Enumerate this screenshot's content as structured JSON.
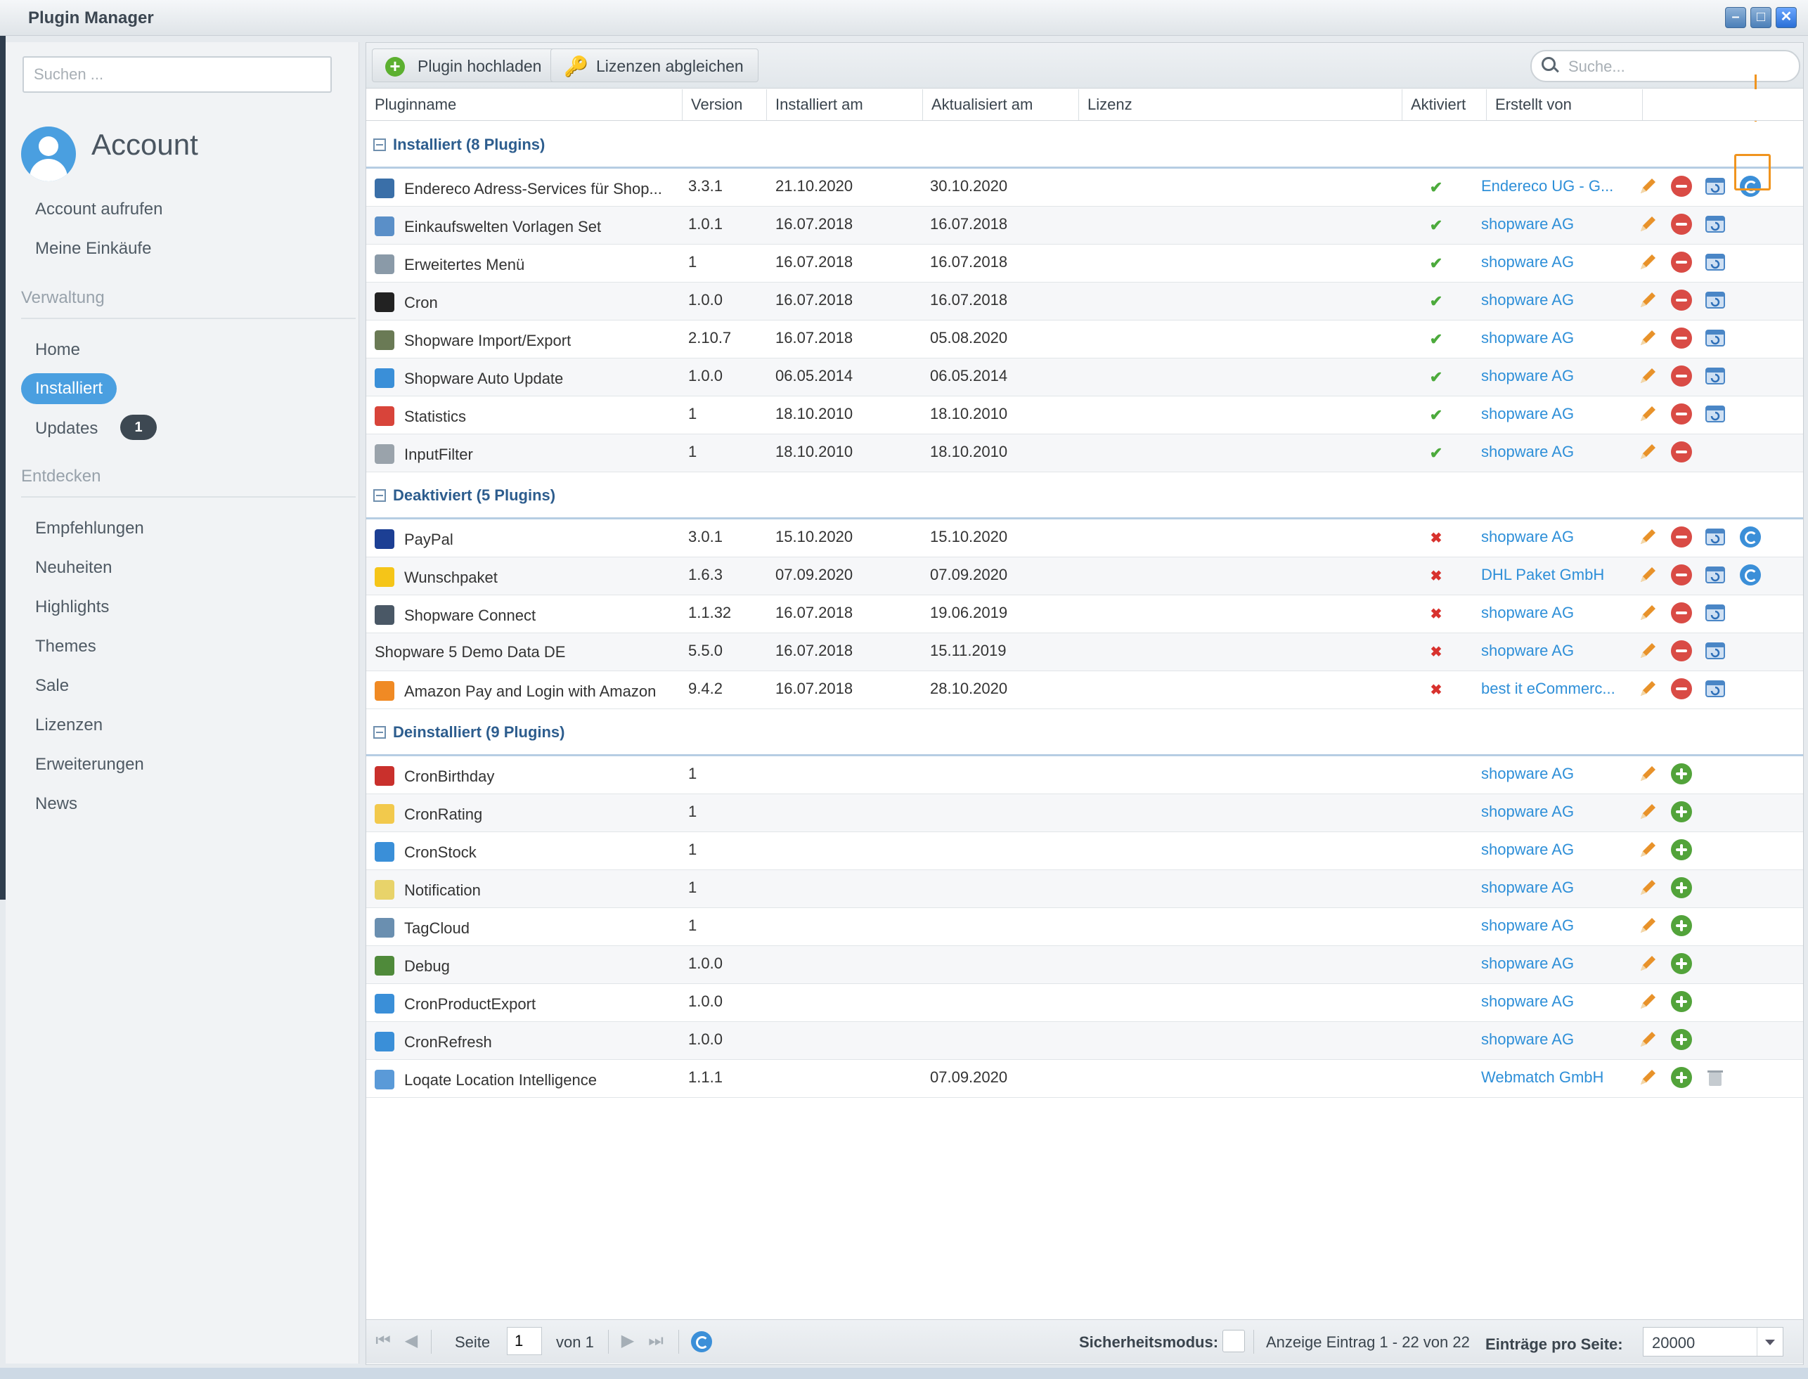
{
  "window": {
    "title": "Plugin Manager"
  },
  "sidebar": {
    "search_placeholder": "Suchen ...",
    "account_title": "Account",
    "account_items": [
      "Account aufrufen",
      "Meine Einkäufe"
    ],
    "sections": [
      {
        "label": "Verwaltung",
        "items": [
          "Home",
          "Installiert",
          "Updates"
        ]
      },
      {
        "label": "Entdecken",
        "items": [
          "Empfehlungen",
          "Neuheiten",
          "Highlights",
          "Themes",
          "Sale",
          "Lizenzen",
          "Erweiterungen",
          "News"
        ]
      }
    ],
    "active_item": "Installiert",
    "updates_badge": "1"
  },
  "toolbar": {
    "upload_label": "Plugin hochladen",
    "licenses_label": "Lizenzen abgleichen",
    "search_placeholder": "Suche..."
  },
  "columns": [
    "Pluginname",
    "Version",
    "Installiert am",
    "Aktualisiert am",
    "Lizenz",
    "Aktiviert",
    "Erstellt von"
  ],
  "groups": [
    {
      "title": "Installiert (8 Plugins)",
      "rows": [
        {
          "name": "Endereco Adress-Services für Shop...",
          "version": "3.3.1",
          "installed": "21.10.2020",
          "updated": "30.10.2020",
          "active": "✔",
          "by": "Endereco UG - G...",
          "icon": "envelope-icon",
          "icon_color": "#3a6fa8",
          "actions": [
            "edit",
            "remove",
            "reinstall",
            "update"
          ]
        },
        {
          "name": "Einkaufswelten Vorlagen Set",
          "version": "1.0.1",
          "installed": "16.07.2018",
          "updated": "16.07.2018",
          "active": "✔",
          "by": "shopware AG",
          "icon": "layout-icon",
          "icon_color": "#5a8fc8",
          "actions": [
            "edit",
            "remove",
            "reinstall"
          ]
        },
        {
          "name": "Erweitertes Menü",
          "version": "1",
          "installed": "16.07.2018",
          "updated": "16.07.2018",
          "active": "✔",
          "by": "shopware AG",
          "icon": "menu-icon",
          "icon_color": "#8a9aa8",
          "actions": [
            "edit",
            "remove",
            "reinstall"
          ]
        },
        {
          "name": "Cron",
          "version": "1.0.0",
          "installed": "16.07.2018",
          "updated": "16.07.2018",
          "active": "✔",
          "by": "shopware AG",
          "icon": "terminal-icon",
          "icon_color": "#222222",
          "actions": [
            "edit",
            "remove",
            "reinstall"
          ]
        },
        {
          "name": "Shopware Import/Export",
          "version": "2.10.7",
          "installed": "16.07.2018",
          "updated": "05.08.2020",
          "active": "✔",
          "by": "shopware AG",
          "icon": "import-export-icon",
          "icon_color": "#6a7a55",
          "actions": [
            "edit",
            "remove",
            "reinstall"
          ]
        },
        {
          "name": "Shopware Auto Update",
          "version": "1.0.0",
          "installed": "06.05.2014",
          "updated": "06.05.2014",
          "active": "✔",
          "by": "shopware AG",
          "icon": "sync-icon",
          "icon_color": "#3a8fd8",
          "actions": [
            "edit",
            "remove",
            "reinstall"
          ]
        },
        {
          "name": "Statistics",
          "version": "1",
          "installed": "18.10.2010",
          "updated": "18.10.2010",
          "active": "✔",
          "by": "shopware AG",
          "icon": "pie-chart-icon",
          "icon_color": "#d8443a",
          "actions": [
            "edit",
            "remove",
            "reinstall"
          ]
        },
        {
          "name": "InputFilter",
          "version": "1",
          "installed": "18.10.2010",
          "updated": "18.10.2010",
          "active": "✔",
          "by": "shopware AG",
          "icon": "text-cursor-icon",
          "icon_color": "#9aa3ab",
          "actions": [
            "edit",
            "remove"
          ]
        }
      ]
    },
    {
      "title": "Deaktiviert (5 Plugins)",
      "rows": [
        {
          "name": "PayPal",
          "version": "3.0.1",
          "installed": "15.10.2020",
          "updated": "15.10.2020",
          "active": "✖",
          "by": "shopware AG",
          "icon": "paypal-icon",
          "icon_color": "#1c3f94",
          "actions": [
            "edit",
            "remove",
            "reinstall",
            "update"
          ]
        },
        {
          "name": "Wunschpaket",
          "version": "1.6.3",
          "installed": "07.09.2020",
          "updated": "07.09.2020",
          "active": "✖",
          "by": "DHL Paket GmbH",
          "icon": "dhl-icon",
          "icon_color": "#f5c518",
          "actions": [
            "edit",
            "remove",
            "reinstall",
            "update"
          ]
        },
        {
          "name": "Shopware Connect",
          "version": "1.1.32",
          "installed": "16.07.2018",
          "updated": "19.06.2019",
          "active": "✖",
          "by": "shopware AG",
          "icon": "connect-icon",
          "icon_color": "#4a5866",
          "actions": [
            "edit",
            "remove",
            "reinstall"
          ]
        },
        {
          "name": "Shopware 5 Demo Data DE",
          "version": "5.5.0",
          "installed": "16.07.2018",
          "updated": "15.11.2019",
          "active": "✖",
          "by": "shopware AG",
          "icon": "",
          "icon_color": "",
          "actions": [
            "edit",
            "remove",
            "reinstall"
          ]
        },
        {
          "name": "Amazon Pay and Login with Amazon",
          "version": "9.4.2",
          "installed": "16.07.2018",
          "updated": "28.10.2020",
          "active": "✖",
          "by": "best it eCommerc...",
          "icon": "amazon-icon",
          "icon_color": "#f08a24",
          "actions": [
            "edit",
            "remove",
            "reinstall"
          ]
        }
      ]
    },
    {
      "title": "Deinstalliert (9 Plugins)",
      "rows": [
        {
          "name": "CronBirthday",
          "version": "1",
          "installed": "",
          "updated": "",
          "active": "",
          "by": "shopware AG",
          "icon": "gift-icon",
          "icon_color": "#c9302c",
          "actions": [
            "edit",
            "install"
          ]
        },
        {
          "name": "CronRating",
          "version": "1",
          "installed": "",
          "updated": "",
          "active": "",
          "by": "shopware AG",
          "icon": "star-icon",
          "icon_color": "#f2c94c",
          "actions": [
            "edit",
            "install"
          ]
        },
        {
          "name": "CronStock",
          "version": "1",
          "installed": "",
          "updated": "",
          "active": "",
          "by": "shopware AG",
          "icon": "trend-chart-icon",
          "icon_color": "#3a8fd8",
          "actions": [
            "edit",
            "install"
          ]
        },
        {
          "name": "Notification",
          "version": "1",
          "installed": "",
          "updated": "",
          "active": "",
          "by": "shopware AG",
          "icon": "speech-bubble-icon",
          "icon_color": "#e8d36a",
          "actions": [
            "edit",
            "install"
          ]
        },
        {
          "name": "TagCloud",
          "version": "1",
          "installed": "",
          "updated": "",
          "active": "",
          "by": "shopware AG",
          "icon": "tag-icon",
          "icon_color": "#6a8fb0",
          "actions": [
            "edit",
            "install"
          ]
        },
        {
          "name": "Debug",
          "version": "1.0.0",
          "installed": "",
          "updated": "",
          "active": "",
          "by": "shopware AG",
          "icon": "bug-icon",
          "icon_color": "#4f8a3a",
          "actions": [
            "edit",
            "install"
          ]
        },
        {
          "name": "CronProductExport",
          "version": "1.0.0",
          "installed": "",
          "updated": "",
          "active": "",
          "by": "shopware AG",
          "icon": "export-icon",
          "icon_color": "#3a8fd8",
          "actions": [
            "edit",
            "install"
          ]
        },
        {
          "name": "CronRefresh",
          "version": "1.0.0",
          "installed": "",
          "updated": "",
          "active": "",
          "by": "shopware AG",
          "icon": "clock-refresh-icon",
          "icon_color": "#3a8fd8",
          "actions": [
            "edit",
            "install"
          ]
        },
        {
          "name": "Loqate Location Intelligence",
          "version": "1.1.1",
          "installed": "",
          "updated": "07.09.2020",
          "active": "",
          "by": "Webmatch GmbH",
          "icon": "layers-icon",
          "icon_color": "#5a9ad8",
          "actions": [
            "edit",
            "install",
            "delete"
          ]
        }
      ]
    }
  ],
  "footer": {
    "page_label": "Seite",
    "page_value": "1",
    "of_label": "von 1",
    "safe_mode_label": "Sicherheitsmodus:",
    "display_text": "Anzeige Eintrag 1 - 22 von 22",
    "per_page_label": "Einträge pro Seite:",
    "per_page_value": "20000"
  },
  "colors": {
    "accent": "#4a9fe0",
    "link": "#2e8fd8",
    "highlight": "#f0941e",
    "active_check": "#4caa3c",
    "inactive_x": "#d8322e"
  }
}
